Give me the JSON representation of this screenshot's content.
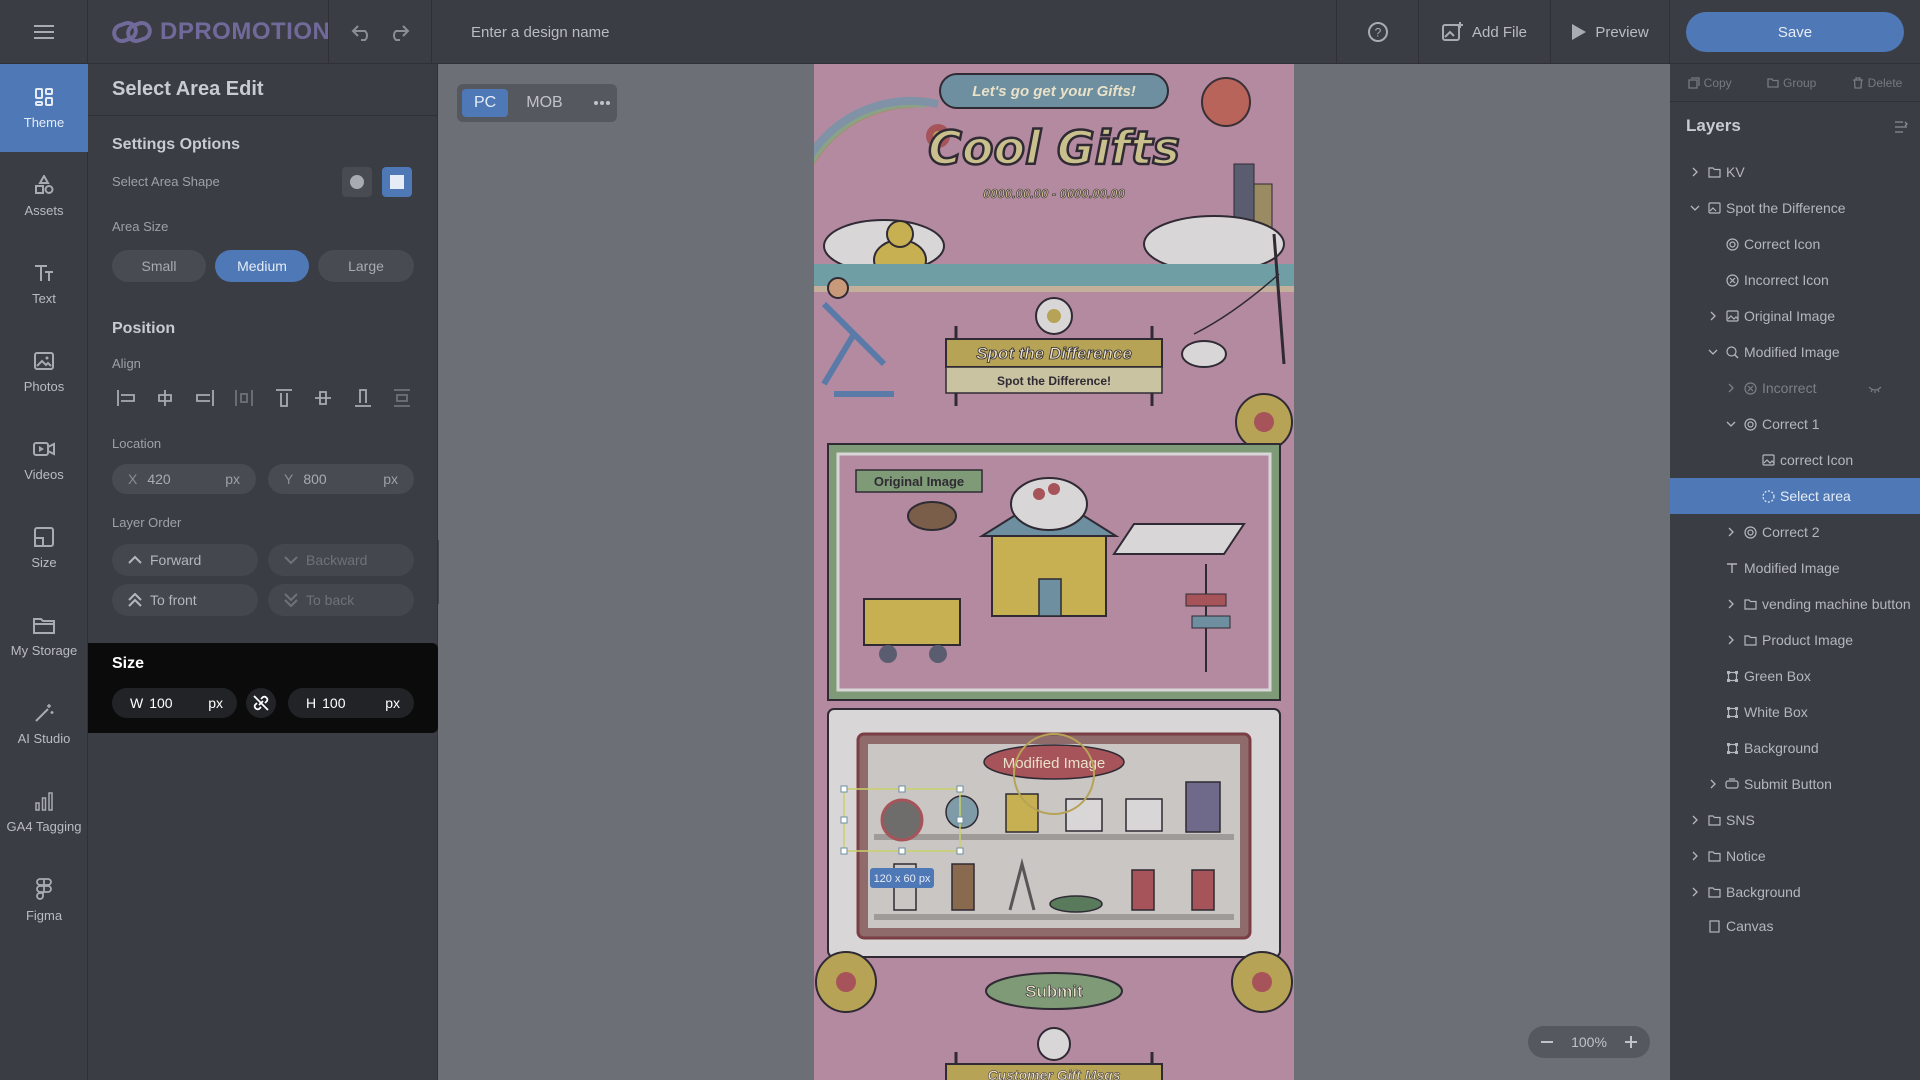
{
  "app": {
    "brand": "DPROMOTION",
    "design_name_placeholder": "Enter a design name"
  },
  "topbar": {
    "add_file": "Add File",
    "preview": "Preview",
    "save": "Save"
  },
  "rail": [
    {
      "label": "Theme",
      "icon": "theme-icon",
      "active": true
    },
    {
      "label": "Assets",
      "icon": "assets-icon"
    },
    {
      "label": "Text",
      "icon": "text-icon"
    },
    {
      "label": "Photos",
      "icon": "photos-icon"
    },
    {
      "label": "Videos",
      "icon": "videos-icon"
    },
    {
      "label": "Size",
      "icon": "size-icon"
    },
    {
      "label": "My Storage",
      "icon": "folder-icon"
    },
    {
      "label": "AI Studio",
      "icon": "ai-wand-icon"
    },
    {
      "label": "GA4 Tagging",
      "icon": "chart-icon"
    },
    {
      "label": "Figma",
      "icon": "figma-icon"
    }
  ],
  "panel": {
    "title": "Select Area Edit",
    "settings_title": "Settings Options",
    "shape_label": "Select Area Shape",
    "area_size_label": "Area Size",
    "sizes": [
      "Small",
      "Medium",
      "Large"
    ],
    "selected_size": "Medium",
    "position_title": "Position",
    "align_label": "Align",
    "location_label": "Location",
    "x_key": "X",
    "x_value": "420",
    "unit": "px",
    "y_key": "Y",
    "y_value": "800",
    "layer_order_label": "Layer Order",
    "forward": "Forward",
    "backward": "Backward",
    "to_front": "To front",
    "to_back": "To back",
    "size_title": "Size",
    "w_key": "W",
    "w_value": "100",
    "h_key": "H",
    "h_value": "100"
  },
  "canvas": {
    "device_pc": "PC",
    "device_mob": "MOB",
    "zoom": "100%",
    "artboard": {
      "bubble": "Let's go get your Gifts!",
      "headline": "Cool Gifts",
      "date_range": "0000.00.00 - 0000.00.00",
      "banner": "Spot the Difference",
      "banner_sub": "Spot the Difference!",
      "original_tag": "Original Image",
      "modified_tag": "Modified Image",
      "selection_badge": "120 x 60 px",
      "submit": "Submit",
      "bottom_banner": "Customer Gift Msgs"
    }
  },
  "right": {
    "copy": "Copy",
    "group": "Group",
    "delete": "Delete",
    "layers_title": "Layers",
    "layers": [
      {
        "label": "KV",
        "depth": 0,
        "chev": "right",
        "icon": "folder-icon"
      },
      {
        "label": "Spot the Difference",
        "depth": 0,
        "chev": "down",
        "icon": "frame-icon"
      },
      {
        "label": "Correct Icon",
        "depth": 1,
        "chev": "",
        "icon": "target-icon"
      },
      {
        "label": "Incorrect Icon",
        "depth": 1,
        "chev": "",
        "icon": "x-circle-icon"
      },
      {
        "label": "Original Image",
        "depth": 1,
        "chev": "right",
        "icon": "image-icon"
      },
      {
        "label": "Modified Image",
        "depth": 1,
        "chev": "down",
        "icon": "search-image-icon"
      },
      {
        "label": "Incorrect",
        "depth": 2,
        "chev": "right",
        "icon": "x-circle-icon",
        "dim": true
      },
      {
        "label": "Correct 1",
        "depth": 2,
        "chev": "down",
        "icon": "target-icon"
      },
      {
        "label": "correct Icon",
        "depth": 3,
        "chev": "",
        "icon": "image-icon"
      },
      {
        "label": "Select area",
        "depth": 3,
        "chev": "",
        "icon": "dashed-circle-icon",
        "selected": true
      },
      {
        "label": "Correct 2",
        "depth": 2,
        "chev": "right",
        "icon": "target-icon"
      },
      {
        "label": "Modified Image",
        "depth": 1,
        "chev": "",
        "icon": "text-icon"
      },
      {
        "label": "vending machine button",
        "depth": 2,
        "chev": "right",
        "icon": "folder-icon"
      },
      {
        "label": "Product Image",
        "depth": 2,
        "chev": "right",
        "icon": "folder-icon"
      },
      {
        "label": "Green Box",
        "depth": 1,
        "chev": "",
        "icon": "shape-icon"
      },
      {
        "label": "White Box",
        "depth": 1,
        "chev": "",
        "icon": "shape-icon"
      },
      {
        "label": "Background",
        "depth": 1,
        "chev": "",
        "icon": "shape-icon"
      },
      {
        "label": "Submit Button",
        "depth": 1,
        "chev": "right",
        "icon": "button-icon"
      },
      {
        "label": "SNS",
        "depth": 0,
        "chev": "right",
        "icon": "folder-icon"
      },
      {
        "label": "Notice",
        "depth": 0,
        "chev": "right",
        "icon": "folder-icon"
      },
      {
        "label": "Background",
        "depth": 0,
        "chev": "right",
        "icon": "folder-icon"
      },
      {
        "label": "Canvas",
        "depth": 0,
        "chev": "",
        "icon": "canvas-icon"
      }
    ]
  },
  "colors": {
    "accent": "#4f78b6",
    "overlay_dark": "#0b0b0b",
    "selection": "#c9d16a"
  }
}
